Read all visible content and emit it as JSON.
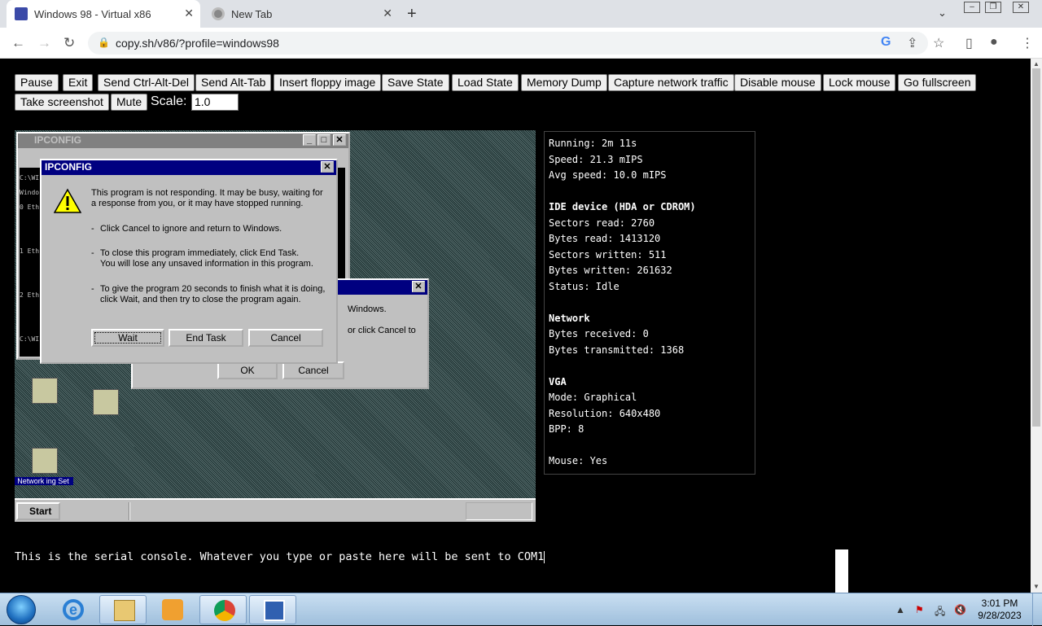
{
  "browser": {
    "tabs": [
      {
        "title": "Windows 98 - Virtual x86",
        "active": true
      },
      {
        "title": "New Tab",
        "active": false
      }
    ],
    "url": "copy.sh/v86/?profile=windows98"
  },
  "toolbar": {
    "buttons_row1": [
      "Pause",
      "Exit",
      "Send Ctrl-Alt-Del",
      "Send Alt-Tab",
      "Insert floppy image",
      "Save State",
      "Load State",
      "Memory Dump",
      "Capture network traffic",
      "Disable mouse",
      "Lock mouse",
      "Go fullscreen"
    ],
    "buttons_row2": [
      "Take screenshot",
      "Mute"
    ],
    "scale_label": "Scale:",
    "scale_value": "1.0"
  },
  "vm": {
    "bg_window_title": "IPCONFIG",
    "dialog": {
      "title": "IPCONFIG",
      "message": "This program is not responding. It may be busy, waiting for\na response from you, or it may have stopped running.",
      "bullet1": "Click Cancel to ignore and return to Windows.",
      "bullet2": "To close this program immediately, click End Task.\nYou will lose any unsaved information in this program.",
      "bullet3": "To give the program 20 seconds to finish what it is doing,\nclick Wait, and then try to close the program again.",
      "wait": "Wait",
      "end_task": "End Task",
      "cancel": "Cancel"
    },
    "second_dialog": {
      "text1": "Windows.",
      "text2": "or click Cancel to",
      "ok": "OK",
      "cancel": "Cancel"
    },
    "console_lines": [
      "C:\\WI",
      "Windo",
      "0 Eth",
      "1 Eth",
      "2 Eth",
      "C:\\WI"
    ],
    "desktop_icon": "Network ing Set",
    "start_label": "Start"
  },
  "stats": {
    "running": "Running: 2m 11s",
    "speed": "Speed: 21.3 mIPS",
    "avg_speed": "Avg speed: 10.0 mIPS",
    "ide_header": "IDE device (HDA or CDROM)",
    "sectors_read": "Sectors read: 2760",
    "bytes_read": "Bytes read: 1413120",
    "sectors_written": "Sectors written: 511",
    "bytes_written": "Bytes written: 261632",
    "status": "Status: Idle",
    "network_header": "Network",
    "bytes_received": "Bytes received: 0",
    "bytes_transmitted": "Bytes transmitted: 1368",
    "vga_header": "VGA",
    "mode": "Mode: Graphical",
    "resolution": "Resolution: 640x480",
    "bpp": "BPP: 8",
    "mouse": "Mouse: Yes"
  },
  "serial": {
    "text": "This is the serial console. Whatever you type or paste here will be sent to COM1"
  },
  "win7": {
    "time": "3:01 PM",
    "date": "9/28/2023"
  }
}
